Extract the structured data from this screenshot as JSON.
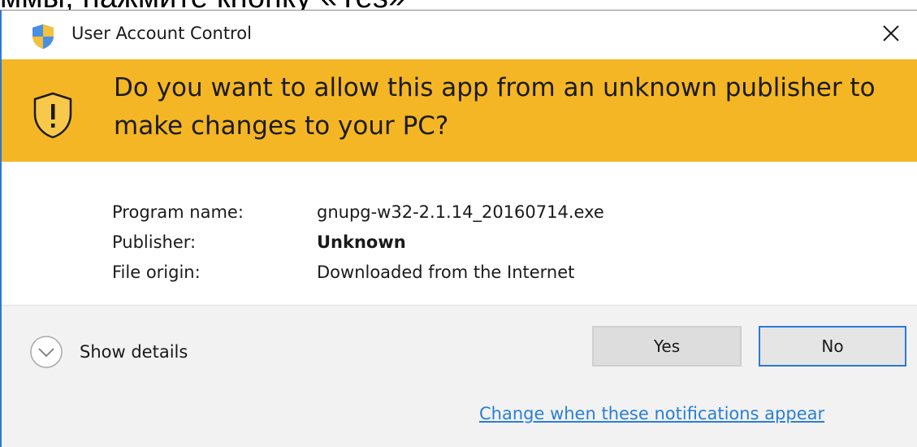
{
  "background_caption": "ммы, нажмите кнопку «Yes»",
  "window": {
    "title": "User Account Control",
    "title_icon": "uac-shield-icon",
    "close_icon": "close-icon"
  },
  "banner": {
    "icon": "warning-shield-icon",
    "text": "Do you want to allow this app from an unknown publisher to make changes to your PC?",
    "color": "#f4b624"
  },
  "details": {
    "rows": [
      {
        "label": "Program name:",
        "value": "gnupg-w32-2.1.14_20160714.exe"
      },
      {
        "label": "Publisher:",
        "value": "Unknown"
      },
      {
        "label": "File origin:",
        "value": "Downloaded from the Internet"
      }
    ]
  },
  "footer": {
    "show_details_label": "Show details",
    "show_details_icon": "chevron-down-icon",
    "yes_label": "Yes",
    "no_label": "No",
    "change_link": "Change when these notifications appear"
  },
  "colors": {
    "accent": "#2b79d6",
    "link": "#2a7fd4",
    "footer_bg": "#f2f2f2"
  }
}
